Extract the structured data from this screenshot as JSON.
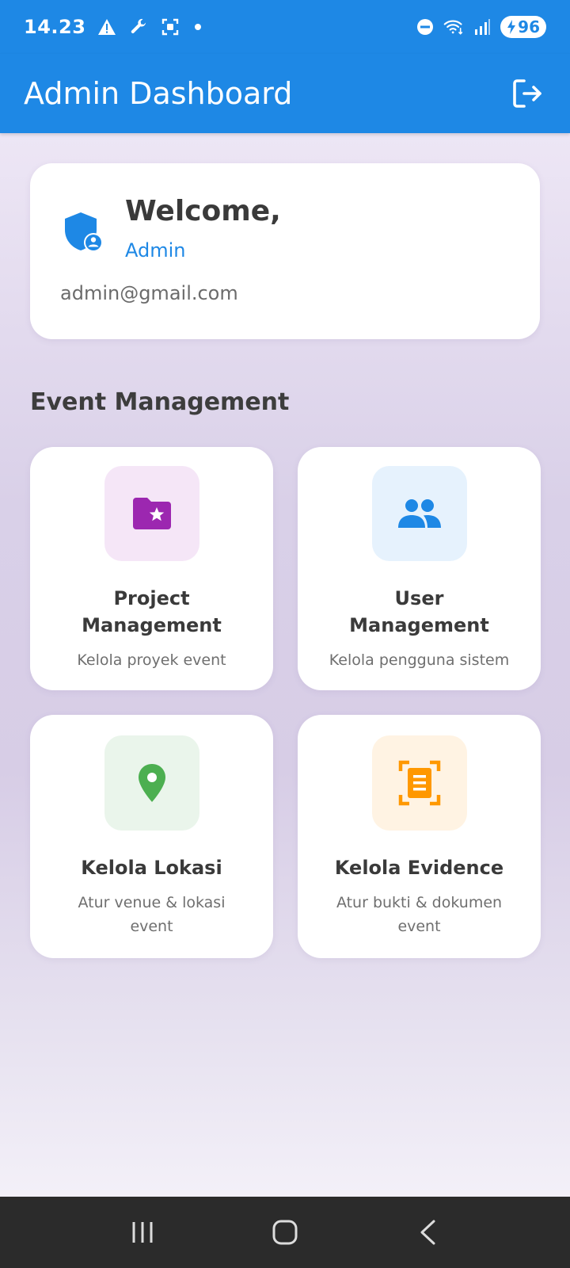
{
  "status_bar": {
    "time": "14.23",
    "battery_level": "96",
    "icons_left": [
      "warning-icon",
      "wrench-icon",
      "screenshot-icon",
      "notification-dot-icon"
    ],
    "icons_right": [
      "do-not-disturb-icon",
      "wifi-icon",
      "signal-icon",
      "battery-charging-icon"
    ]
  },
  "app_bar": {
    "title": "Admin Dashboard",
    "action_icon": "logout-icon"
  },
  "welcome_card": {
    "title": "Welcome,",
    "name": "Admin",
    "email": "admin@gmail.com",
    "icon": "admin-shield-icon"
  },
  "section": {
    "title": "Event Management"
  },
  "tiles": [
    {
      "title": "Project Management",
      "subtitle": "Kelola proyek event",
      "icon": "folder-star-icon",
      "icon_color": "#9C27B0",
      "bg_color": "#F5E6F7"
    },
    {
      "title": "User Management",
      "subtitle": "Kelola pengguna sistem",
      "icon": "people-icon",
      "icon_color": "#1E88E5",
      "bg_color": "#E6F2FD"
    },
    {
      "title": "Kelola Lokasi",
      "subtitle": "Atur venue & lokasi event",
      "icon": "location-pin-icon",
      "icon_color": "#4CAF50",
      "bg_color": "#EAF5EB"
    },
    {
      "title": "Kelola Evidence",
      "subtitle": "Atur bukti & dokumen event",
      "icon": "document-scan-icon",
      "icon_color": "#FF9800",
      "bg_color": "#FFF3E3"
    }
  ],
  "nav_bar": {
    "buttons": [
      "recent-apps-icon",
      "home-icon",
      "back-icon"
    ]
  },
  "colors": {
    "primary": "#1E88E5",
    "nav_background": "#2b2b2b"
  }
}
